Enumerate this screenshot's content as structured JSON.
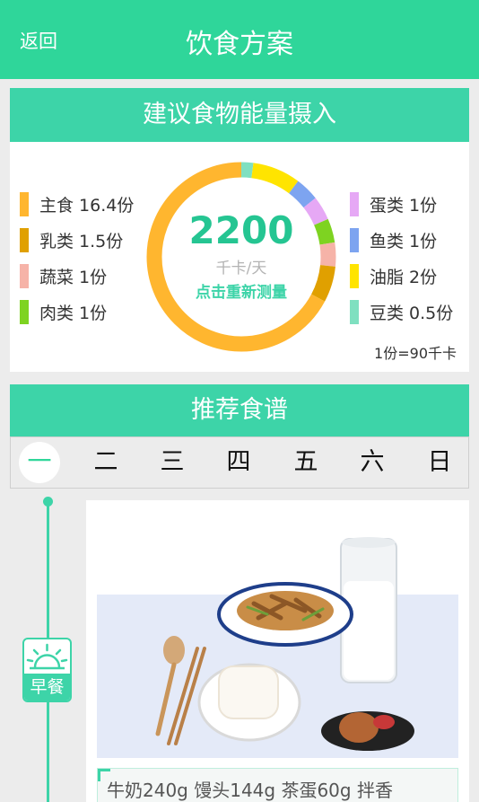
{
  "header": {
    "back_label": "返回",
    "title": "饮食方案"
  },
  "energy": {
    "section_title": "建议食物能量摄入",
    "calories": "2200",
    "unit": "千卡/天",
    "remeasure_label": "点击重新测量",
    "footnote": "1份=90千卡",
    "legend_left": [
      {
        "label": "主食 16.4份",
        "color": "#ffb62f",
        "portions": 16.4
      },
      {
        "label": "乳类 1.5份",
        "color": "#e0a000",
        "portions": 1.5
      },
      {
        "label": "蔬菜 1份",
        "color": "#f6b3a8",
        "portions": 1
      },
      {
        "label": "肉类 1份",
        "color": "#7ed321",
        "portions": 1
      }
    ],
    "legend_right": [
      {
        "label": "蛋类 1份",
        "color": "#e6a8f5",
        "portions": 1
      },
      {
        "label": "鱼类 1份",
        "color": "#7da4f0",
        "portions": 1
      },
      {
        "label": "油脂 2份",
        "color": "#ffe400",
        "portions": 2
      },
      {
        "label": "豆类 0.5份",
        "color": "#7fe0c0",
        "portions": 0.5
      }
    ]
  },
  "recipes": {
    "section_title": "推荐食谱",
    "days": [
      "一",
      "二",
      "三",
      "四",
      "五",
      "六",
      "日"
    ],
    "active_day_index": 0,
    "meal": {
      "badge_label": "早餐",
      "badge_icon": "sunrise-icon",
      "photo_icon": "breakfast-photo",
      "description": "牛奶240g 馒头144g 茶蛋60g 拌香"
    }
  }
}
